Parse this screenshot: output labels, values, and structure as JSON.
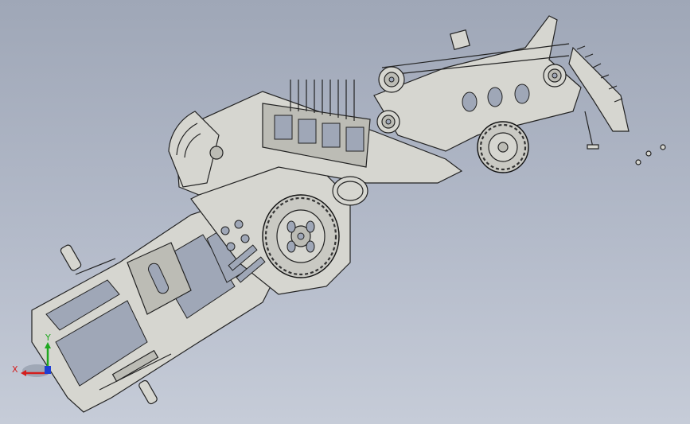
{
  "triad": {
    "x_label": "X",
    "y_label": "Y",
    "x_color": "#d41e1e",
    "y_color": "#1fa81f",
    "z_color": "#1e3fd4"
  },
  "colors": {
    "background_top": "#9fa7b7",
    "background_bottom": "#c6ccd8",
    "part_fill": "#d6d6d0",
    "edge": "#222222"
  }
}
